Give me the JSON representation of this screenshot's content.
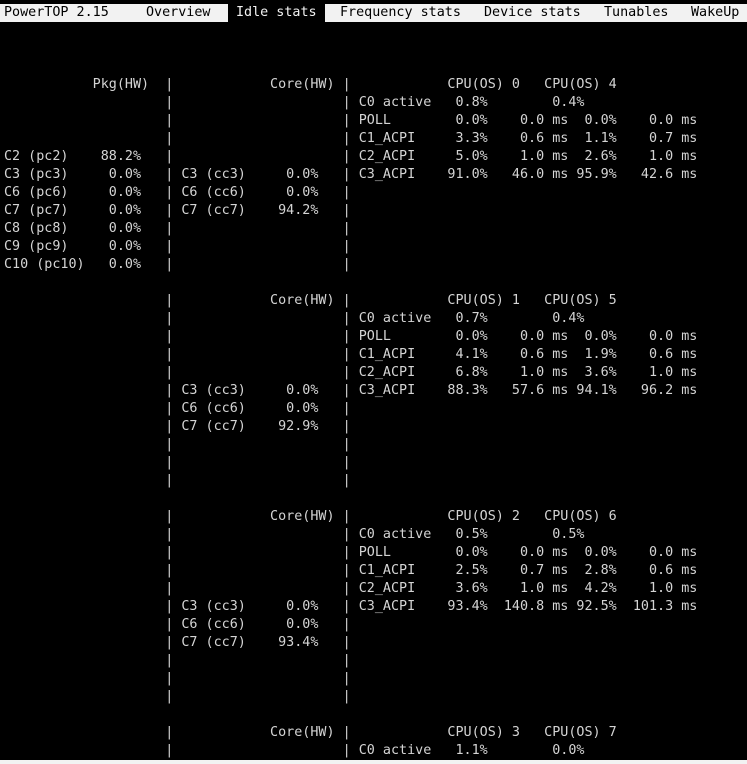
{
  "app": {
    "title": "PowerTOP 2.15"
  },
  "tabs": [
    {
      "label": "Overview",
      "active": false
    },
    {
      "label": "Idle stats",
      "active": true
    },
    {
      "label": "Frequency stats",
      "active": false
    },
    {
      "label": "Device stats",
      "active": false
    },
    {
      "label": "Tunables",
      "active": false
    },
    {
      "label": "WakeUp",
      "active": false
    }
  ],
  "colors": {
    "background": "#000000",
    "text": "#d4d4d4",
    "menubar_bg": "#f2f2f2",
    "menubar_text": "#000000"
  },
  "screen_lines": [
    "",
    "",
    "",
    "           Pkg(HW)  |            Core(HW) |            CPU(OS) 0   CPU(OS) 4",
    "                    |                     | C0 active   0.8%        0.4%",
    "                    |                     | POLL        0.0%    0.0 ms  0.0%    0.0 ms",
    "                    |                     | C1_ACPI     3.3%    0.6 ms  1.1%    0.7 ms",
    "C2 (pc2)    88.2%   |                     | C2_ACPI     5.0%    1.0 ms  2.6%    1.0 ms",
    "C3 (pc3)     0.0%   | C3 (cc3)     0.0%   | C3_ACPI    91.0%   46.0 ms 95.9%   42.6 ms",
    "C6 (pc6)     0.0%   | C6 (cc6)     0.0%   |",
    "C7 (pc7)     0.0%   | C7 (cc7)    94.2%   |",
    "C8 (pc8)     0.0%   |                     |",
    "C9 (pc9)     0.0%   |                     |",
    "C10 (pc10)   0.0%   |                     |",
    "",
    "                    |            Core(HW) |            CPU(OS) 1   CPU(OS) 5",
    "                    |                     | C0 active   0.7%        0.4%",
    "                    |                     | POLL        0.0%    0.0 ms  0.0%    0.0 ms",
    "                    |                     | C1_ACPI     4.1%    0.6 ms  1.9%    0.6 ms",
    "                    |                     | C2_ACPI     6.8%    1.0 ms  3.6%    1.0 ms",
    "                    | C3 (cc3)     0.0%   | C3_ACPI    88.3%   57.6 ms 94.1%   96.2 ms",
    "                    | C6 (cc6)     0.0%   |",
    "                    | C7 (cc7)    92.9%   |",
    "                    |                     |",
    "                    |                     |",
    "                    |                     |",
    "",
    "                    |            Core(HW) |            CPU(OS) 2   CPU(OS) 6",
    "                    |                     | C0 active   0.5%        0.5%",
    "                    |                     | POLL        0.0%    0.0 ms  0.0%    0.0 ms",
    "                    |                     | C1_ACPI     2.5%    0.7 ms  2.8%    0.6 ms",
    "                    |                     | C2_ACPI     3.6%    1.0 ms  4.2%    1.0 ms",
    "                    | C3 (cc3)     0.0%   | C3_ACPI    93.4%  140.8 ms 92.5%  101.3 ms",
    "                    | C6 (cc6)     0.0%   |",
    "                    | C7 (cc7)    93.4%   |",
    "                    |                     |",
    "                    |                     |",
    "                    |                     |",
    "",
    "                    |            Core(HW) |            CPU(OS) 3   CPU(OS) 7",
    "                    |                     | C0 active   1.1%        0.0%"
  ]
}
